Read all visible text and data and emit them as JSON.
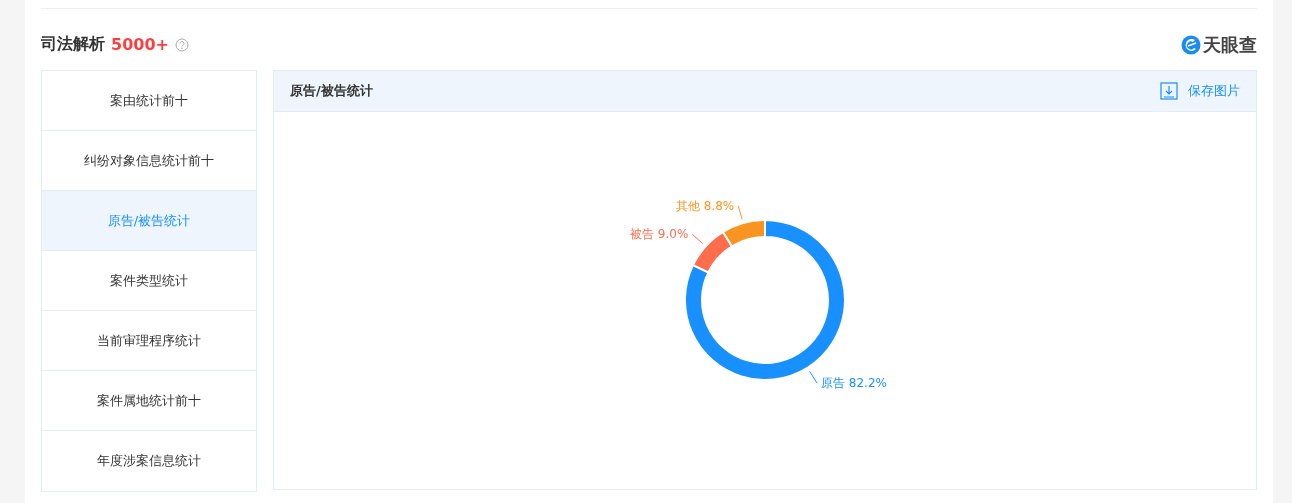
{
  "section": {
    "title": "司法解析",
    "count": "5000+",
    "logo_text": "天眼查"
  },
  "sidebar": {
    "items": [
      {
        "label": "案由统计前十",
        "selected": false
      },
      {
        "label": "纠纷对象信息统计前十",
        "selected": false
      },
      {
        "label": "原告/被告统计",
        "selected": true
      },
      {
        "label": "案件类型统计",
        "selected": false
      },
      {
        "label": "当前审理程序统计",
        "selected": false
      },
      {
        "label": "案件属地统计前十",
        "selected": false
      },
      {
        "label": "年度涉案信息统计",
        "selected": false
      }
    ]
  },
  "panel": {
    "title": "原告/被告统计",
    "save_button": "保存图片",
    "chart_data": {
      "type": "donut",
      "categories": [
        "原告",
        "被告",
        "其他"
      ],
      "values": [
        82.2,
        9.0,
        8.8
      ],
      "value_labels": [
        "82.2%",
        "9.0%",
        "8.8%"
      ]
    }
  }
}
